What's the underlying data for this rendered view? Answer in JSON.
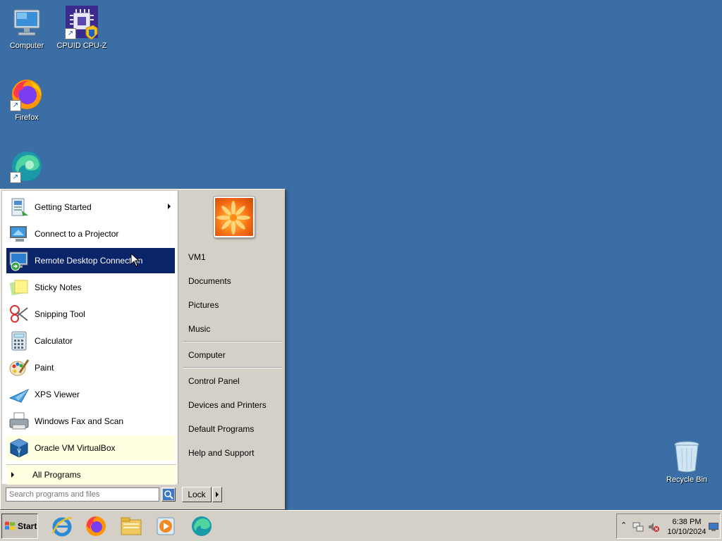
{
  "desktop": {
    "icons": [
      {
        "label": "Computer"
      },
      {
        "label": "CPUID CPU-Z"
      },
      {
        "label": "Firefox"
      },
      {
        "label": "Recycle Bin"
      }
    ]
  },
  "start_menu": {
    "programs": [
      {
        "label": "Getting Started",
        "has_submenu": true
      },
      {
        "label": "Connect to a Projector"
      },
      {
        "label": "Remote Desktop Connection",
        "selected": true
      },
      {
        "label": "Sticky Notes"
      },
      {
        "label": "Snipping Tool"
      },
      {
        "label": "Calculator"
      },
      {
        "label": "Paint"
      },
      {
        "label": "XPS Viewer"
      },
      {
        "label": "Windows Fax and Scan"
      },
      {
        "label": "Oracle VM VirtualBox",
        "pinned": true
      }
    ],
    "all_programs": "All Programs",
    "search_placeholder": "Search programs and files",
    "right_items": [
      "VM1",
      "Documents",
      "Pictures",
      "Music",
      "Computer",
      "Control Panel",
      "Devices and Printers",
      "Default Programs",
      "Help and Support"
    ],
    "lock_label": "Lock"
  },
  "taskbar": {
    "start_label": "Start",
    "time": "6:38 PM",
    "date": "10/10/2024"
  },
  "colors": {
    "desktop": "#3a6ea5",
    "selection": "#0a246a",
    "pinned_bg": "#ffffe1",
    "chrome": "#d4d0c8"
  }
}
